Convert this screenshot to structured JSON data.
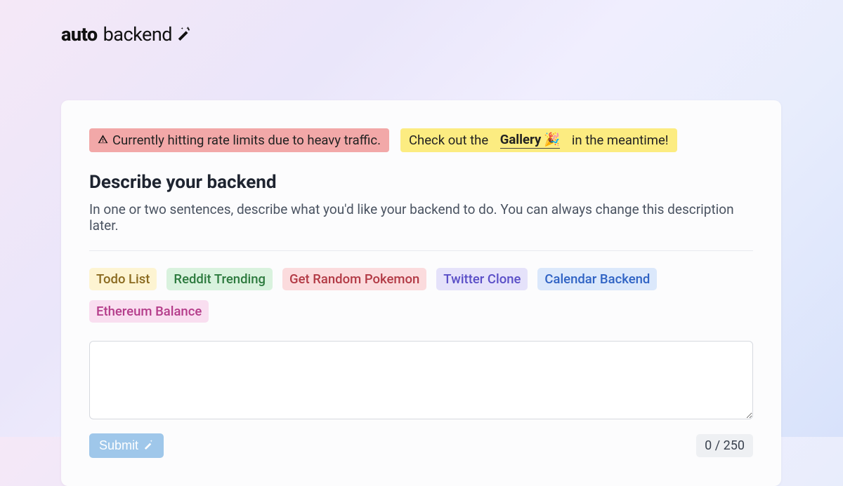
{
  "logo": {
    "bold": "auto",
    "light": "backend"
  },
  "alerts": {
    "rate_limit": "Currently hitting rate limits due to heavy traffic.",
    "gallery_pre": "Check out the",
    "gallery_link": "Gallery",
    "gallery_post": "in the meantime!"
  },
  "section": {
    "title": "Describe your backend",
    "subtitle": "In one or two sentences, describe what you'd like your backend to do. You can always change this description later."
  },
  "chips": [
    {
      "label": "Todo List",
      "bg": "#fdf4d2",
      "fg": "#8a6a1f"
    },
    {
      "label": "Reddit Trending",
      "bg": "#d9f2de",
      "fg": "#2c7a3e"
    },
    {
      "label": "Get Random Pokemon",
      "bg": "#fbdbdd",
      "fg": "#b23a45"
    },
    {
      "label": "Twitter Clone",
      "bg": "#e5e2fa",
      "fg": "#5a4fc7"
    },
    {
      "label": "Calendar Backend",
      "bg": "#dbe8fb",
      "fg": "#2f63c4"
    },
    {
      "label": "Ethereum Balance",
      "bg": "#f9def0",
      "fg": "#b43c8a"
    }
  ],
  "textarea": {
    "value": ""
  },
  "submit": {
    "label": "Submit"
  },
  "counter": {
    "text": "0 / 250"
  }
}
